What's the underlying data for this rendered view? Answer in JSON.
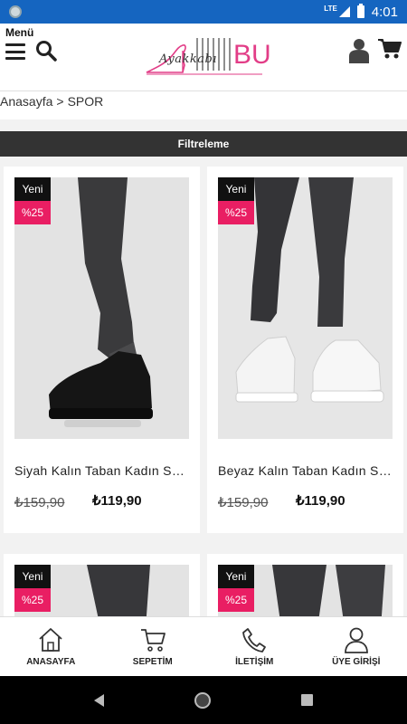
{
  "status_bar": {
    "network": "LTE",
    "time": "4:01"
  },
  "header": {
    "menu_label": "Menü",
    "logo_text": "Ayakkabı",
    "logo_bu": "BU",
    "accent_color": "#e23d87"
  },
  "breadcrumb": {
    "items": [
      "Anasayfa",
      ">",
      "SPOR"
    ]
  },
  "filter": {
    "label": "Filtreleme"
  },
  "products": [
    {
      "badge_new": "Yeni",
      "badge_discount": "%25",
      "name": "Siyah Kalın Taban Kadın Spor Ayakkabı",
      "old_price": "₺159,90",
      "price": "₺119,90",
      "shoe_color": "black"
    },
    {
      "badge_new": "Yeni",
      "badge_discount": "%25",
      "name": "Beyaz Kalın Taban Kadın Spor Ayakkabı",
      "old_price": "₺159,90",
      "price": "₺119,90",
      "shoe_color": "white"
    },
    {
      "badge_new": "Yeni",
      "badge_discount": "%25"
    },
    {
      "badge_new": "Yeni",
      "badge_discount": "%25"
    }
  ],
  "bottom_nav": [
    {
      "label": "ANASAYFA",
      "icon": "home-icon"
    },
    {
      "label": "SEPETİM",
      "icon": "cart-icon"
    },
    {
      "label": "İLETİŞİM",
      "icon": "phone-icon"
    },
    {
      "label": "ÜYE GİRİŞİ",
      "icon": "user-icon"
    }
  ],
  "colors": {
    "status_bar": "#1565c0",
    "discount_badge": "#e91e63",
    "new_badge": "#111111",
    "filter_bar": "#333333"
  }
}
